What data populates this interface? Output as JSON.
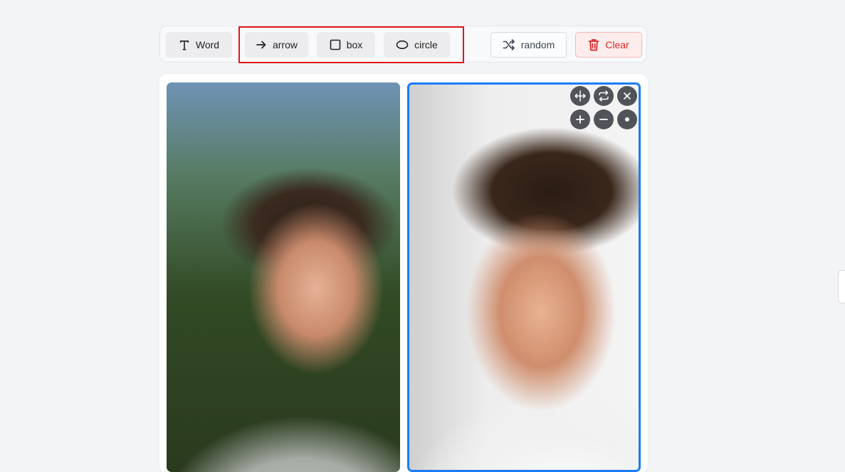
{
  "toolbar": {
    "word_label": "Word",
    "arrow_label": "arrow",
    "box_label": "box",
    "circle_label": "circle",
    "random_label": "random",
    "clear_label": "Clear"
  },
  "icons": {
    "word": "text-t-icon",
    "arrow": "arrow-right-icon",
    "box": "square-icon",
    "circle": "ellipse-icon",
    "random": "shuffle-icon",
    "clear": "trash-icon"
  },
  "image_controls": [
    "move-icon",
    "swap-icon",
    "close-icon",
    "zoom-in-icon",
    "zoom-out-icon",
    "reset-dot-icon"
  ],
  "colors": {
    "accent": "#1a7cf5",
    "highlight": "#e0161d",
    "clear_text": "#dc2626",
    "clear_bg": "#fdecec"
  }
}
